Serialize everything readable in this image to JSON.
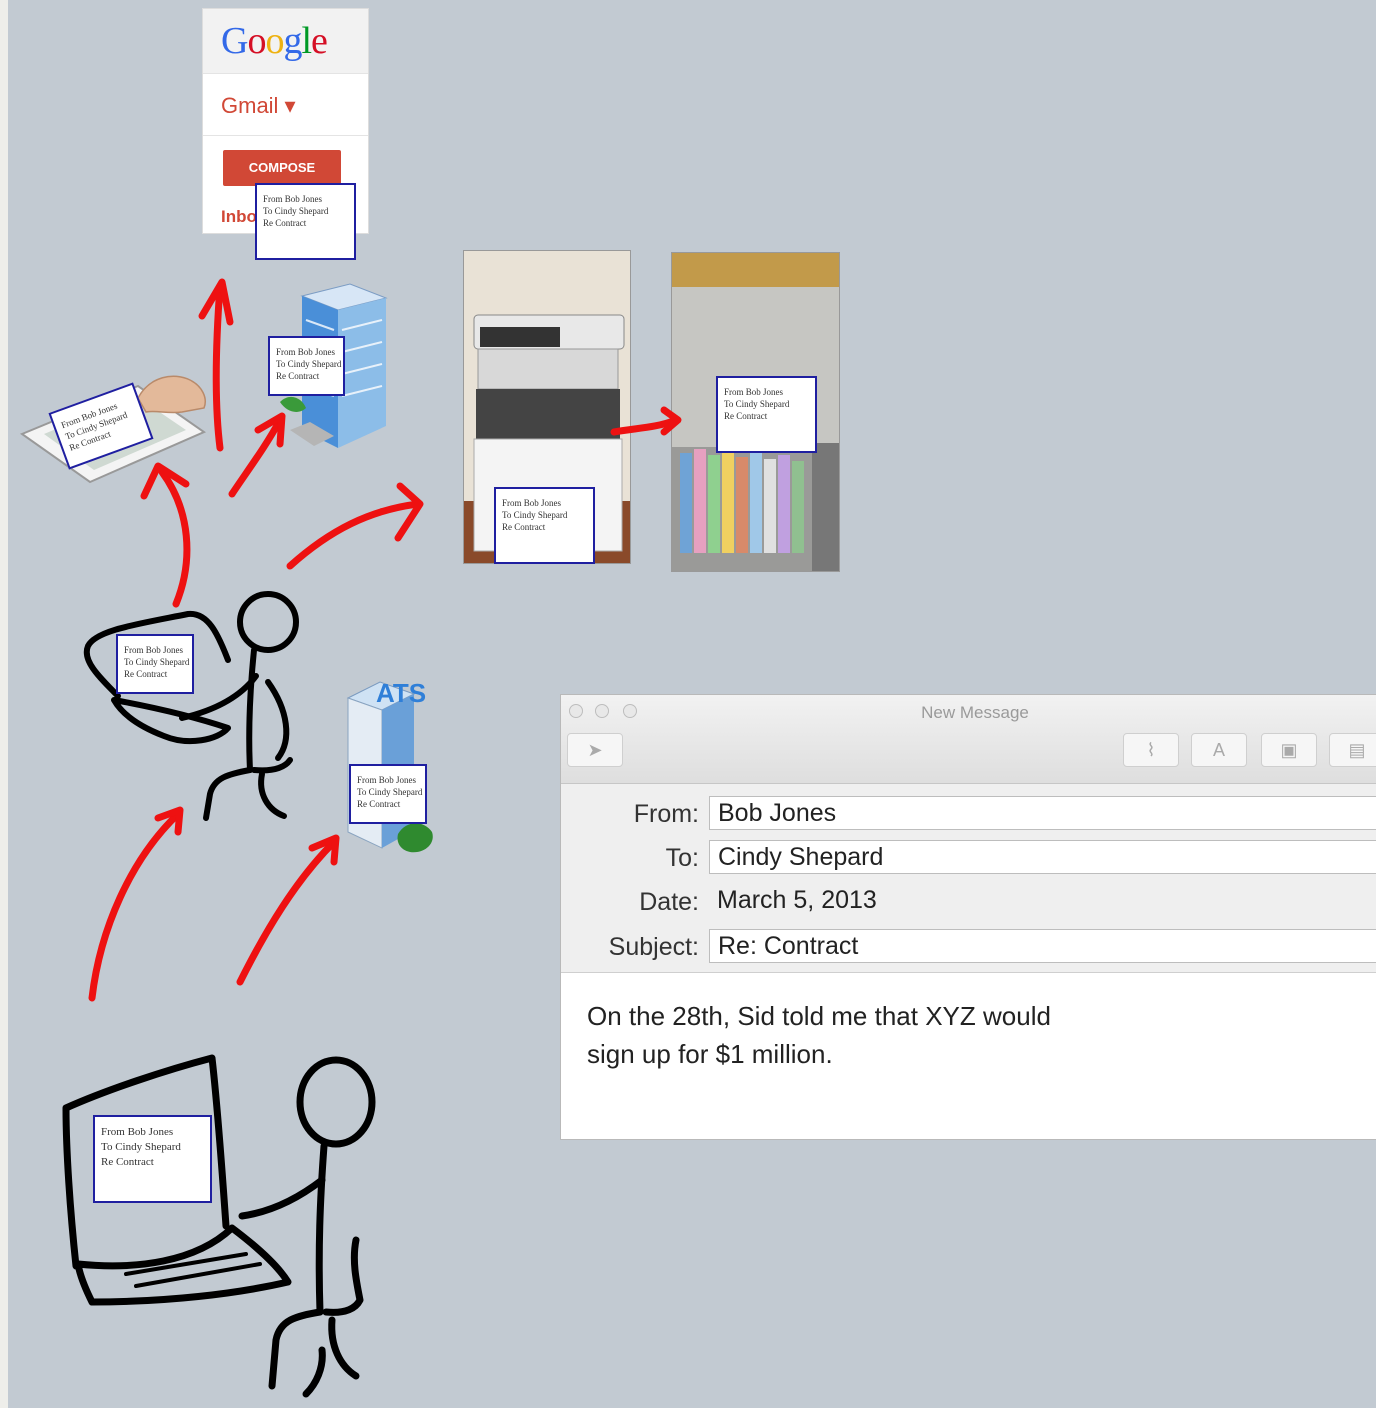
{
  "note": {
    "from": "From Bob Jones",
    "to": "To Cindy Shepard",
    "re": "Re Contract"
  },
  "gmail": {
    "logo_letters": [
      {
        "ch": "G",
        "color": "#3369e8"
      },
      {
        "ch": "o",
        "color": "#d50f25"
      },
      {
        "ch": "o",
        "color": "#eeb211"
      },
      {
        "ch": "g",
        "color": "#3369e8"
      },
      {
        "ch": "l",
        "color": "#009925"
      },
      {
        "ch": "e",
        "color": "#d50f25"
      }
    ],
    "label": "Gmail ▾",
    "compose": "COMPOSE",
    "inbox": "Inbox"
  },
  "building": {
    "sign": "ATS"
  },
  "mail_window": {
    "title": "New Message",
    "fields": [
      {
        "label": "From:",
        "value": "Bob Jones",
        "boxed": true
      },
      {
        "label": "To:",
        "value": "Cindy Shepard",
        "boxed": true
      },
      {
        "label": "Date:",
        "value": "March 5, 2013",
        "boxed": false
      },
      {
        "label": "Subject:",
        "value": "Re: Contract",
        "boxed": true
      }
    ],
    "body_line1": "On the 28th, Sid told me that XYZ would",
    "body_line2": "sign up for $1 million."
  },
  "colors": {
    "background": "#c2cad2",
    "arrow": "#ee1111",
    "note_border": "#1f1fa0",
    "compose": "#d14836"
  }
}
